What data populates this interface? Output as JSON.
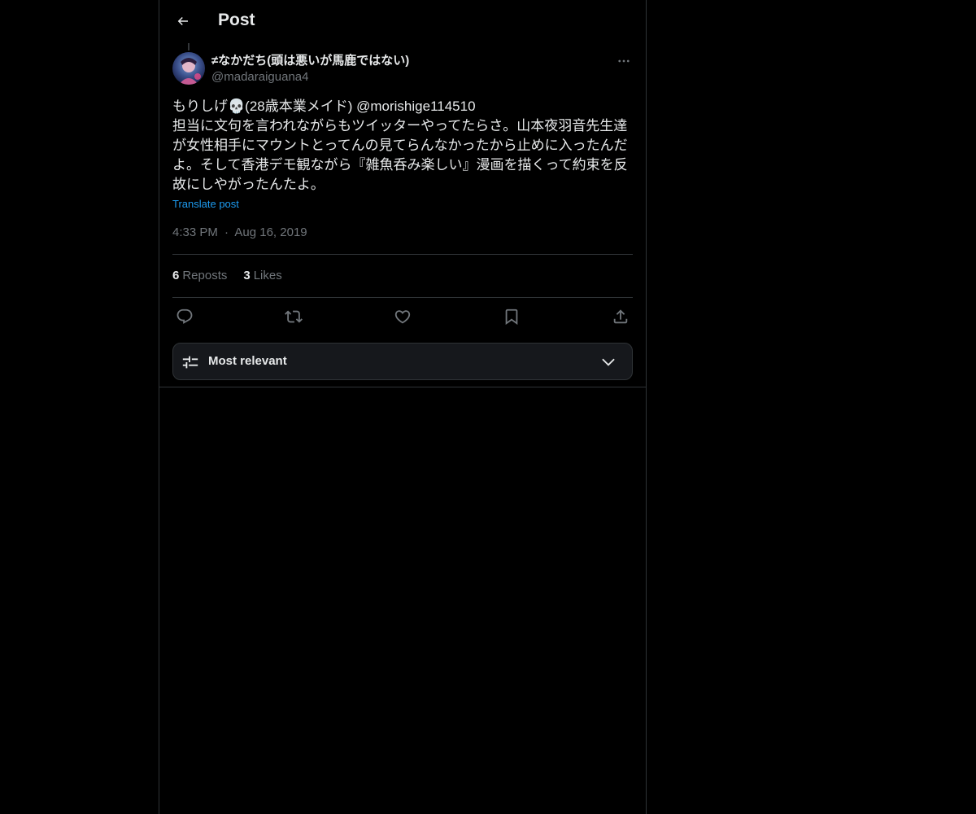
{
  "header": {
    "title": "Post",
    "back_icon": "arrow-left-icon"
  },
  "post": {
    "author": {
      "display_name": "≠なかだち(頭は悪いが馬鹿ではない)",
      "handle": "@madaraiguana4"
    },
    "text_line1_prefix": "もりしげ",
    "text_line1_suffix": "(28歳本業メイド) @morishige114510",
    "text_body": "担当に文句を言われながらもツイッターやってたらさ。山本夜羽音先生達が女性相手にマウントとってんの見てらんなかったから止めに入ったんだよ。そして香港デモ観ながら『雑魚呑み楽しい』漫画を描くって約束を反故にしやがったんたよ。",
    "translate_label": "Translate post",
    "time": "4:33 PM",
    "date": "Aug 16, 2019",
    "separator": "·",
    "reposts_count": "6",
    "reposts_label": "Reposts",
    "likes_count": "3",
    "likes_label": "Likes"
  },
  "actions": {
    "reply_icon": "reply-icon",
    "repost_icon": "repost-icon",
    "like_icon": "heart-icon",
    "bookmark_icon": "bookmark-icon",
    "share_icon": "share-icon"
  },
  "sort": {
    "label": "Most relevant"
  },
  "colors": {
    "background": "#000000",
    "text": "#e7e9ea",
    "secondary": "#71767b",
    "accent": "#1d9bf0",
    "border": "#2f3336"
  }
}
